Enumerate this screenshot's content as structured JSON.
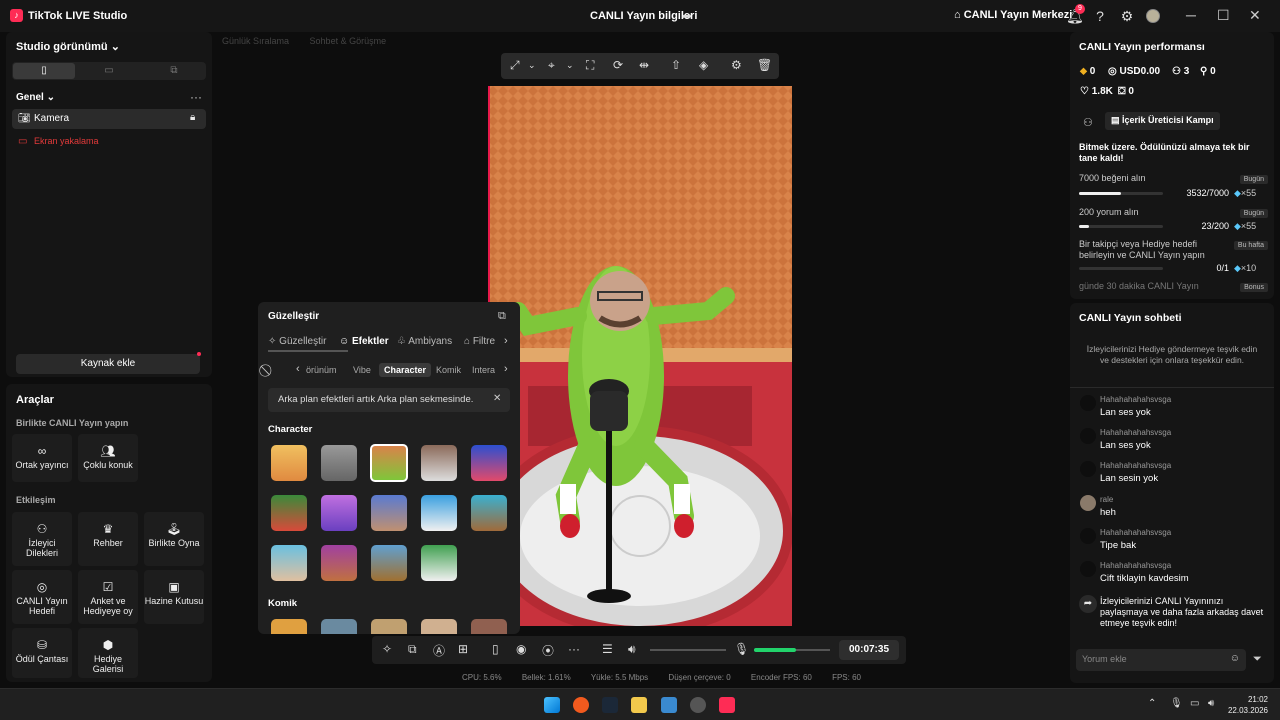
{
  "titlebar": {
    "app_name": "TikTok LIVE Studio",
    "center_title": "CANLI Yayın bilgileri",
    "hub_label": "CANLI Yayın Merkezi",
    "notification_count": "9"
  },
  "left": {
    "studio_view": "Studio görünümü",
    "section_general": "Genel",
    "sources": [
      "Kamera",
      "Ekran yakalama"
    ],
    "add_source": "Kaynak ekle"
  },
  "tools": {
    "title": "Araçlar",
    "collab_section": "Birlikte CANLI Yayın yapın",
    "collab": [
      "Ortak yayıncı",
      "Çoklu konuk"
    ],
    "engage_section": "Etkileşim",
    "engage": [
      "İzleyici Dilekleri",
      "Rehber",
      "Birlikte Oyna",
      "CANLI Yayın Hedefi",
      "Anket ve Hediyeye oy",
      "Hazine Kutusu",
      "Ödül Çantası",
      "Hediye Galerisi"
    ]
  },
  "center": {
    "faded_tabs": [
      "Günlük Sıralama",
      "Sohbet & Görüşme"
    ]
  },
  "beauty": {
    "title": "Güzelleştir",
    "tabs": [
      "Güzelleştir",
      "Efektler",
      "Ambiyans",
      "Filtre"
    ],
    "categories": [
      "örünüm",
      "Vibe",
      "Character",
      "Komik",
      "Intera"
    ],
    "notice": "Arka plan efektleri artık Arka plan sekmesinde.",
    "section_character": "Character",
    "section_komik": "Komik"
  },
  "bottombar": {
    "timer": "00:07:35"
  },
  "stats": {
    "cpu": "CPU: 5.6%",
    "memory": "Bellek: 1.61%",
    "upload": "Yükle: 5.5 Mbps",
    "dropped": "Düşen çerçeve: 0",
    "encoder": "Encoder FPS: 60",
    "fps": "FPS: 60"
  },
  "perf": {
    "title": "CANLI Yayın performansı",
    "coins": "0",
    "usd": "USD0.00",
    "viewers": "3",
    "followers": "0",
    "likes": "1.8K",
    "gifts": "0",
    "camp": "İçerik Üreticisi Kampı",
    "headline": "Bitmek üzere. Ödülünüzü almaya tek bir tane kaldı!",
    "tasks": [
      {
        "label": "7000 beğeni alın",
        "tag": "Bugün",
        "progress": "3532/7000",
        "reward": "×55",
        "fraction": 0.5
      },
      {
        "label": "200 yorum alın",
        "tag": "Bugün",
        "progress": "23/200",
        "reward": "×55",
        "fraction": 0.115
      },
      {
        "label": "Bir takipçi veya Hediye hedefi belirleyin ve CANLI Yayın yapın",
        "tag": "Bu hafta",
        "progress": "0/1",
        "reward": "×10",
        "fraction": 0
      },
      {
        "label": "günde 30 dakika CANLI Yayın",
        "tag": "Bonus",
        "progress": "",
        "reward": "",
        "fraction": 0
      }
    ]
  },
  "chat": {
    "title": "CANLI Yayın sohbeti",
    "intro": "İzleyicilerinizi Hediye göndermeye teşvik edin ve destekleri için onlara teşekkür edin.",
    "messages": [
      {
        "user": "Hahahahahahsvsga",
        "text": "Lan ses yok"
      },
      {
        "user": "Hahahahahahsvsga",
        "text": "Lan ses yok"
      },
      {
        "user": "Hahahahahahsvsga",
        "text": "Lan sesin yok"
      },
      {
        "user": "rale",
        "text": "heh"
      },
      {
        "user": "Hahahahahahsvsga",
        "text": "Tipe bak"
      },
      {
        "user": "Hahahahahahsvsga",
        "text": "Cift tiklayin kavdesim"
      }
    ],
    "share_tip": "İzleyicilerinizi CANLI Yayınınızı paylaşmaya ve daha fazla arkadaş davet etmeye teşvik edin!",
    "input_placeholder": "Yorum ekle"
  },
  "taskbar": {
    "time": "21:02",
    "date": "22.03.2026"
  },
  "colors": {
    "accent": "#fe2c55",
    "progress_green": "#22d36b"
  }
}
